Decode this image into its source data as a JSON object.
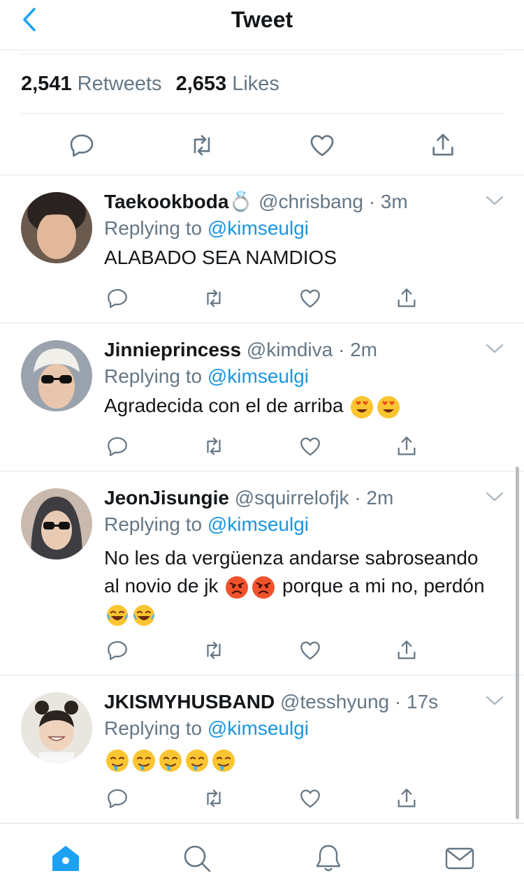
{
  "header": {
    "title": "Tweet"
  },
  "stats": {
    "retweets_count": "2,541",
    "retweets_label": "Retweets",
    "likes_count": "2,653",
    "likes_label": "Likes"
  },
  "colors": {
    "accent": "#1da1f2",
    "mention": "#1b95e0",
    "secondary_text": "#657786",
    "divider": "#e1e8ed"
  },
  "icons": [
    "chevron-left-icon",
    "reply-icon",
    "retweet-icon",
    "like-icon",
    "share-icon",
    "chevron-down-icon",
    "home-icon",
    "search-icon",
    "notifications-icon",
    "messages-icon"
  ],
  "replies": [
    {
      "name": "Taekookboda💍",
      "handle": "@chrisbang",
      "time": "· 3m",
      "replying_prefix": "Replying to",
      "replying_to": "@kimseulgi",
      "text": "ALABADO SEA NAMDIOS",
      "emojis": []
    },
    {
      "name": "Jinnieprincess",
      "handle": "@kimdiva",
      "time": "· 2m",
      "replying_prefix": "Replying to",
      "replying_to": "@kimseulgi",
      "text": "Agradecida con el de arriba",
      "emojis": [
        "heart-eyes",
        "heart-eyes"
      ]
    },
    {
      "name": "JeonJisungie",
      "handle": "@squirrelofjk",
      "time": "· 2m",
      "replying_prefix": "Replying to",
      "replying_to": "@kimseulgi",
      "text_parts": [
        " No les da vergüenza andarse sabroseando al novio de jk",
        "porque a mi no, perdón"
      ],
      "emojis": [
        "angry",
        "angry",
        "tears-of-joy",
        "tears-of-joy"
      ]
    },
    {
      "name": "JKISMYHUSBAND",
      "handle": "@tesshyung",
      "time": "· 17s",
      "replying_prefix": "Replying to",
      "replying_to": "@kimseulgi",
      "text": "",
      "emojis": [
        "drooling",
        "drooling",
        "drooling",
        "drooling",
        "drooling"
      ]
    }
  ]
}
